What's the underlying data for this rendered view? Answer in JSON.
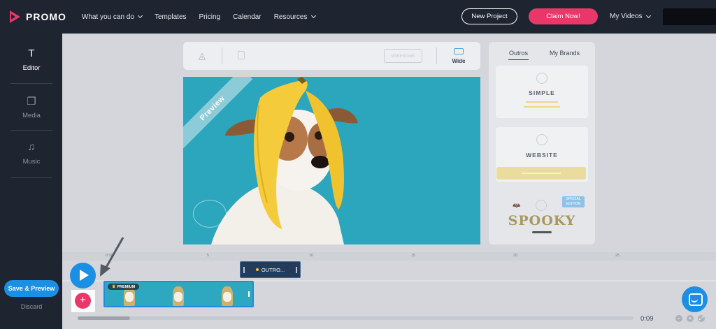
{
  "nav": {
    "brand": "PROMO",
    "links": [
      "What you can do",
      "Templates",
      "Pricing",
      "Calendar",
      "Resources"
    ],
    "new_project": "New Project",
    "claim": "Claim Now!",
    "my_videos": "My Videos"
  },
  "sidebar": {
    "items": [
      {
        "label": "Editor",
        "icon": "text-T-icon"
      },
      {
        "label": "Media",
        "icon": "media-icon"
      },
      {
        "label": "Music",
        "icon": "music-note-icon"
      }
    ],
    "save_preview": "Save & Preview",
    "discard": "Discard"
  },
  "toolbar": {
    "watermark_pill": "Watermark",
    "wide": "Wide"
  },
  "preview": {
    "ribbon": "Preview"
  },
  "panel": {
    "tabs": [
      "Outros",
      "My Brands"
    ],
    "cards": [
      "SIMPLE",
      "WEBSITE",
      "SPOOKY"
    ],
    "badge": "SPECIAL EDITION"
  },
  "timeline": {
    "ticks": [
      "0:00",
      "5",
      "10",
      "15",
      "20",
      "25"
    ],
    "outro_label": "OUTRO...",
    "premium_label": "PREMIUM",
    "time": "0:09"
  },
  "colors": {
    "nav_bg": "#1e2430",
    "accent_pink": "#e8386a",
    "accent_blue": "#1a8fe3",
    "preview_teal": "#2ba6bd"
  }
}
